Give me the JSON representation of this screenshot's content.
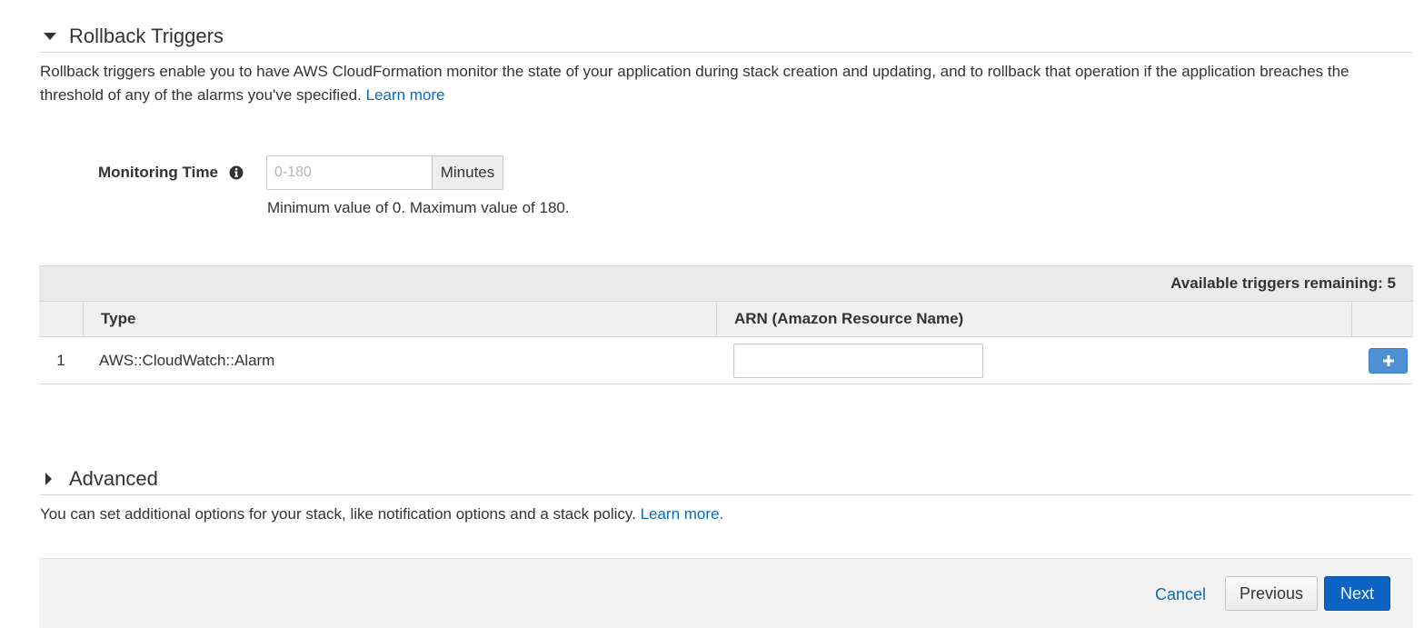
{
  "rollback": {
    "title": "Rollback Triggers",
    "description": "Rollback triggers enable you to have AWS CloudFormation monitor the state of your application during stack creation and updating, and to rollback that operation if the application breaches the threshold of any of the alarms you've specified.",
    "learn_more": "Learn more"
  },
  "monitoring": {
    "label": "Monitoring Time",
    "info_icon": "info-icon",
    "placeholder": "0-180",
    "value": "",
    "unit": "Minutes",
    "help": "Minimum value of 0. Maximum value of 180."
  },
  "triggers": {
    "remaining_text": "Available triggers remaining: 5",
    "columns": {
      "type": "Type",
      "arn": "ARN (Amazon Resource Name)"
    },
    "rows": [
      {
        "index": "1",
        "type": "AWS::CloudWatch::Alarm",
        "arn": ""
      }
    ],
    "add_icon": "plus-icon"
  },
  "advanced": {
    "title": "Advanced",
    "description": "You can set additional options for your stack, like notification options and a stack policy.",
    "learn_more": "Learn more."
  },
  "footer": {
    "cancel": "Cancel",
    "previous": "Previous",
    "next": "Next"
  },
  "colors": {
    "link": "#0f6ab4",
    "primary": "#0d63c4",
    "add_button": "#4f8fd4"
  }
}
